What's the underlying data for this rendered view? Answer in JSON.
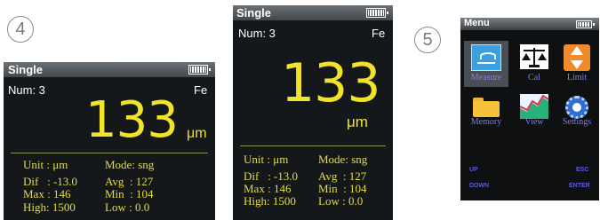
{
  "steps": {
    "step4": "4",
    "step5": "5"
  },
  "screen_a": {
    "title": "Single",
    "num_label": "Num: 3",
    "material": "Fe",
    "value": "133",
    "unit_display": "μm",
    "stats": {
      "unit": "Unit : μm",
      "mode": "Mode: sng",
      "dif": "Dif   : -13.0",
      "avg": "Avg  : 127",
      "max": "Max : 146",
      "min": "Min  : 104",
      "high": "High: 1500",
      "low": "Low : 0.0"
    }
  },
  "screen_b": {
    "title": "Single",
    "num_label": "Num: 3",
    "material": "Fe",
    "value": "133",
    "unit_display": "μm",
    "stats": {
      "unit": "Unit : μm",
      "mode": "Mode: sng",
      "dif": "Dif   : -13.0",
      "avg": "Avg  : 127",
      "max": "Max : 146",
      "min": "Min  : 104",
      "high": "High: 1500",
      "low": "Low : 0.0"
    }
  },
  "menu_screen": {
    "title": "Menu",
    "items": [
      {
        "label": "Measure",
        "icon": "measure-icon",
        "selected": true
      },
      {
        "label": "Cal",
        "icon": "balance-scale-icon",
        "selected": false
      },
      {
        "label": "Limit",
        "icon": "up-down-arrows-icon",
        "selected": false
      },
      {
        "label": "Memory",
        "icon": "folder-icon",
        "selected": false
      },
      {
        "label": "View",
        "icon": "chart-icon",
        "selected": false
      },
      {
        "label": "Settings",
        "icon": "gear-icon",
        "selected": false
      }
    ],
    "softkeys": {
      "up": "UP",
      "down": "DOWN",
      "esc": "ESC",
      "enter": "ENTER"
    }
  },
  "colors": {
    "screen_bg": "#14181b",
    "reading": "#f0e32a",
    "menu_label": "#7b7cf0"
  }
}
